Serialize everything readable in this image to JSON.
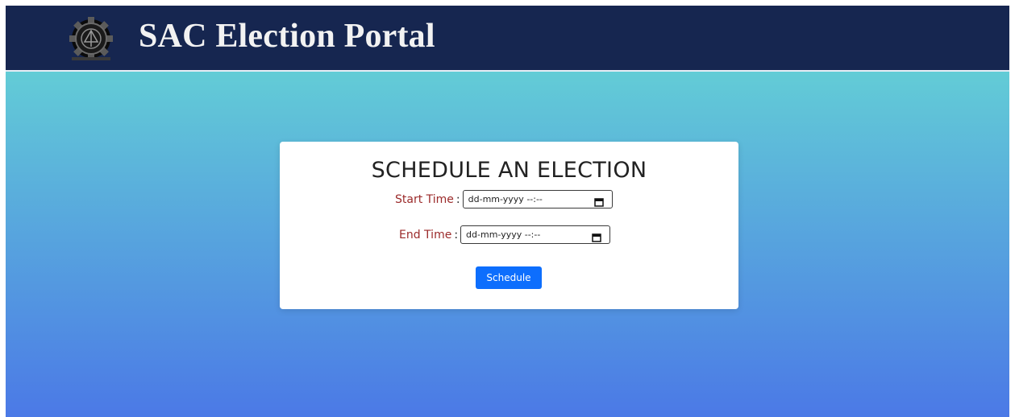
{
  "header": {
    "title": "SAC Election Portal",
    "logo_icon": "gear-emblem-icon"
  },
  "form": {
    "title": "SCHEDULE AN ELECTION",
    "start_label": "Start Time",
    "start_colon": ":",
    "start_value": "dd-mm-yyyy --:--",
    "end_label": "End Time",
    "end_colon": ":",
    "end_value": "dd-mm-yyyy --:--",
    "calendar_icon": "calendar-icon",
    "submit_label": "Schedule"
  },
  "colors": {
    "navbar": "#162650",
    "gradient_top": "#67dcd3",
    "gradient_bottom": "#4b79e6",
    "label": "#9b2a2a",
    "button": "#0d6efd"
  }
}
